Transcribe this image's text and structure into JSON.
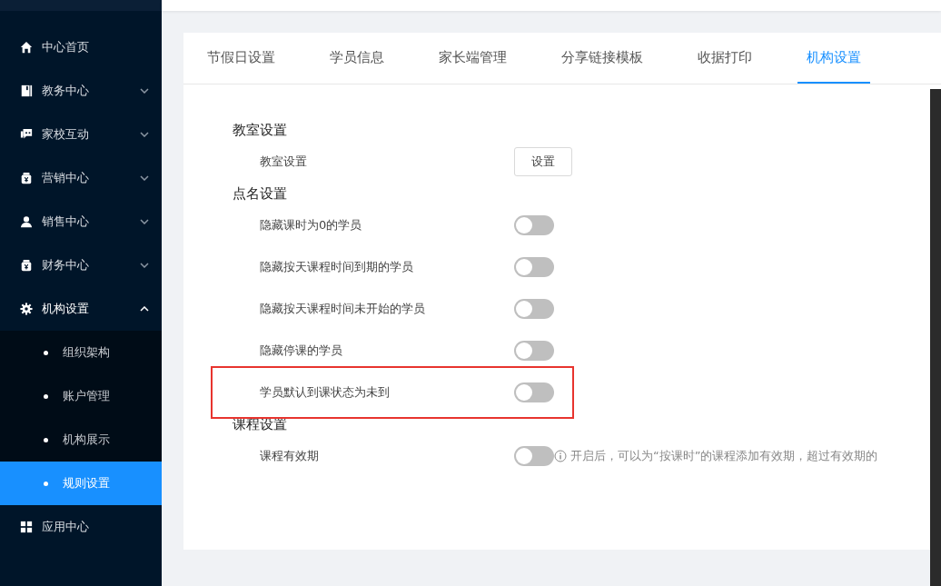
{
  "sidebar": {
    "items": [
      {
        "label": "中心首页",
        "kind": "home",
        "expanded": false,
        "has_caret": false
      },
      {
        "label": "教务中心",
        "kind": "book",
        "expanded": false,
        "has_caret": true
      },
      {
        "label": "家校互动",
        "kind": "chat",
        "expanded": false,
        "has_caret": true
      },
      {
        "label": "营销中心",
        "kind": "bag",
        "expanded": false,
        "has_caret": true
      },
      {
        "label": "销售中心",
        "kind": "person",
        "expanded": false,
        "has_caret": true
      },
      {
        "label": "财务中心",
        "kind": "bag",
        "expanded": false,
        "has_caret": true
      },
      {
        "label": "机构设置",
        "kind": "gear",
        "expanded": true,
        "has_caret": true,
        "children": [
          {
            "label": "组织架构",
            "selected": false
          },
          {
            "label": "账户管理",
            "selected": false
          },
          {
            "label": "机构展示",
            "selected": false
          },
          {
            "label": "规则设置",
            "selected": true
          }
        ]
      },
      {
        "label": "应用中心",
        "kind": "grid",
        "expanded": false,
        "has_caret": false
      }
    ]
  },
  "tabs": [
    {
      "label": "节假日设置",
      "selected": false
    },
    {
      "label": "学员信息",
      "selected": false
    },
    {
      "label": "家长端管理",
      "selected": false
    },
    {
      "label": "分享链接模板",
      "selected": false
    },
    {
      "label": "收据打印",
      "selected": false
    },
    {
      "label": "机构设置",
      "selected": true
    }
  ],
  "sections": [
    {
      "title": "教室设置",
      "rows": [
        {
          "kind": "button",
          "label": "教室设置",
          "button": "设置",
          "highlighted": false
        }
      ]
    },
    {
      "title": "点名设置",
      "rows": [
        {
          "kind": "switch",
          "label": "隐藏课时为0的学员",
          "on": false,
          "highlighted": false
        },
        {
          "kind": "switch",
          "label": "隐藏按天课程时间到期的学员",
          "on": false,
          "highlighted": false
        },
        {
          "kind": "switch",
          "label": "隐藏按天课程时间未开始的学员",
          "on": false,
          "highlighted": false
        },
        {
          "kind": "switch",
          "label": "隐藏停课的学员",
          "on": false,
          "highlighted": false
        },
        {
          "kind": "switch",
          "label": "学员默认到课状态为未到",
          "on": false,
          "highlighted": true
        }
      ]
    },
    {
      "title": "课程设置",
      "rows": [
        {
          "kind": "switch",
          "label": "课程有效期",
          "on": false,
          "highlighted": false,
          "hint": "开启后，可以为“按课时”的课程添加有效期，超过有效期的"
        }
      ]
    }
  ]
}
